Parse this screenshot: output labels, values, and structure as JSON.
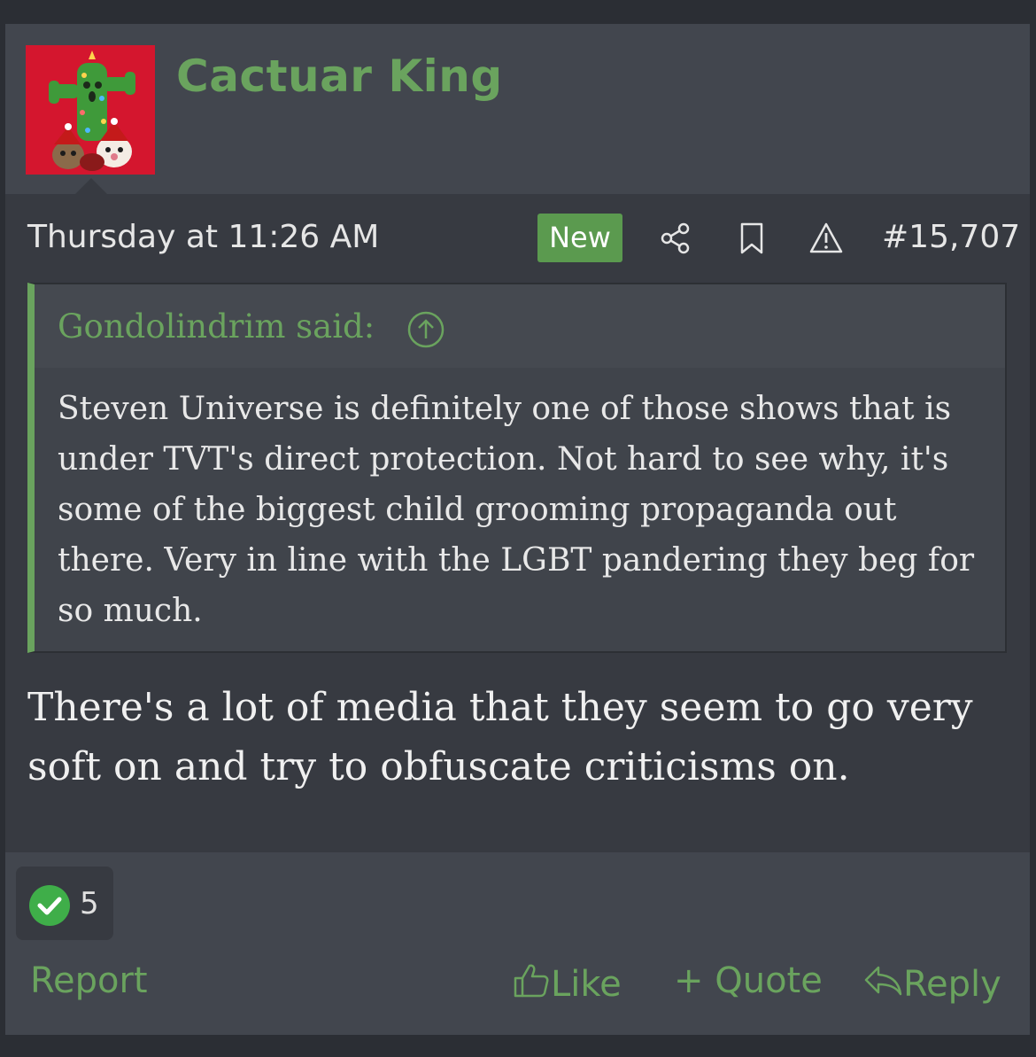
{
  "post": {
    "author": "Cactuar King",
    "date": "Thursday at 11:26 AM",
    "badge": "New",
    "number": "#15,707",
    "icons": [
      "share-icon",
      "bookmark-icon",
      "warning-icon"
    ]
  },
  "quote": {
    "author": "Gondolindrim said:",
    "body": "Steven Universe is definitely one of those shows that is under TVT's direct protection. Not hard to see why, it's some of the biggest child grooming propaganda out there. Very in line with the LGBT pandering they beg for so much."
  },
  "message": "There's a lot of media that they seem to go very soft on and try to obfuscate criticisms on.",
  "reactions": {
    "count": "5",
    "icon": "check-circle-icon"
  },
  "actions": {
    "report": "Report",
    "like": "Like",
    "quote": "+ Quote",
    "reply": "Reply"
  },
  "colors": {
    "accent": "#6aa35e",
    "background": "#373a41",
    "header": "#42464e"
  }
}
